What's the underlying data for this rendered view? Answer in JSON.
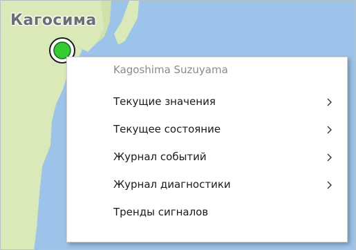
{
  "map": {
    "city_label": "Кагосима",
    "station_status_color": "#33cc33",
    "water_color": "#9cc3ea",
    "land_color": "#d9e9b8"
  },
  "context_menu": {
    "header": "Kagoshima Suzuyama",
    "items": [
      {
        "label": "Текущие значения",
        "has_submenu": true,
        "icon": "chevron-right-icon"
      },
      {
        "label": "Текущее состояние",
        "has_submenu": true,
        "icon": "chevron-right-icon"
      },
      {
        "label": "Журнал событий",
        "has_submenu": true,
        "icon": "chevron-right-icon"
      },
      {
        "label": "Журнал диагностики",
        "has_submenu": true,
        "icon": "chevron-right-icon"
      },
      {
        "label": "Тренды сигналов",
        "has_submenu": false
      }
    ]
  }
}
